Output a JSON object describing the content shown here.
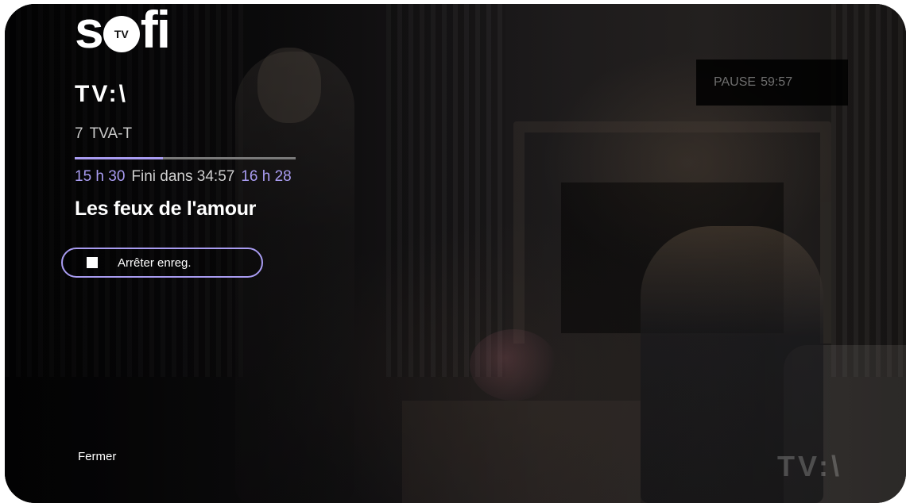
{
  "brand": {
    "logo_letters": [
      "s",
      "f",
      "i"
    ],
    "logo_badge": "TV"
  },
  "channel": {
    "network_logo": "TV:\\",
    "number": "7",
    "name": "TVA-T",
    "watermark": "TV:\\"
  },
  "program": {
    "start_time": "15 h 30",
    "remaining_text": "Fini dans 34:57",
    "end_time": "16 h 28",
    "title": "Les feux de l'amour",
    "progress_fraction": 0.4
  },
  "actions": {
    "stop_recording_label": "Arrêter enreg.",
    "close_label": "Fermer"
  },
  "pause": {
    "label": "PAUSE",
    "time": "59:57"
  },
  "colors": {
    "accent": "#a99cf2",
    "text": "#ffffff",
    "muted": "#c9c9c9"
  }
}
